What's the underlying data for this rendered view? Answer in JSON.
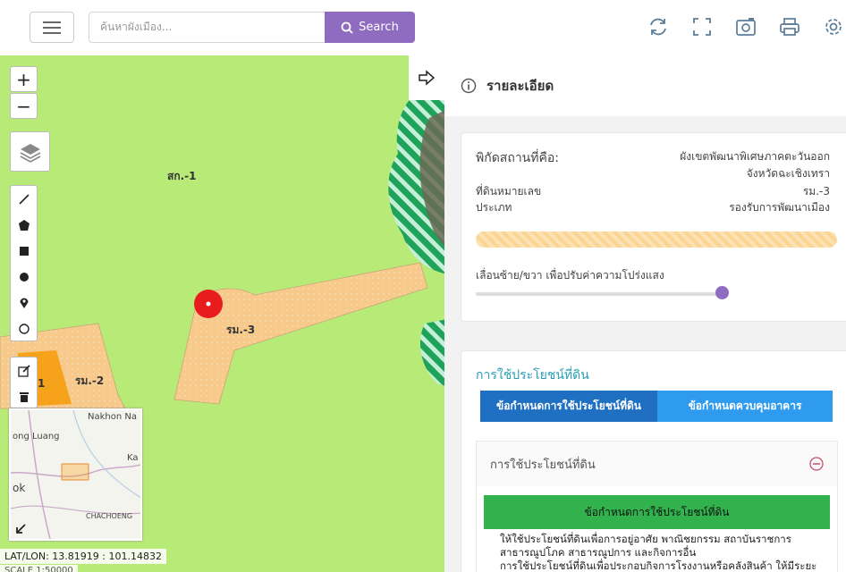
{
  "toolbar": {
    "search_placeholder": "ค้นหาผังเมือง...",
    "search_label": "Search",
    "icons": [
      "menu-icon",
      "search-icon",
      "refresh-icon",
      "fullscreen-icon",
      "screenshot-icon",
      "print-icon",
      "settings-icon"
    ]
  },
  "map": {
    "zoom_in": "+",
    "zoom_out": "−",
    "zones": [
      {
        "label": "สก.-1",
        "color": "#b8ea78"
      },
      {
        "label": "รม.-3",
        "color": "#f7c98b"
      },
      {
        "label": "รม.-2",
        "color": "#f7c98b"
      },
      {
        "label": "1",
        "color": "#f7a21b"
      }
    ],
    "minimap_labels": [
      "Nakhon Na",
      "ong Luang",
      "Ka",
      "ok",
      "CHACHOENG"
    ],
    "latlon": "LAT/LON: 13.81919 : 101.14832",
    "scale": "SCALE 1:50000",
    "marker_color": "#e81c1c"
  },
  "panel": {
    "title": "รายละเอียด",
    "details": [
      {
        "label": "พิกัดสถานที่คือ:",
        "value_line1": "ผังเขตพัฒนาพิเศษภาคตะวันออก",
        "value_line2": "จังหวัดฉะเชิงเทรา"
      },
      {
        "label": "ที่ดินหมายเลข",
        "value": "รม.-3"
      },
      {
        "label": "ประเภท",
        "value": "รองรับการพัฒนาเมือง"
      }
    ],
    "opacity_label": "เลื่อนซ้าย/ขวา เพื่อปรับค่าความโปร่งแสง",
    "opacity_level": 0.98,
    "landuse_title": "การใช้ประโยชน์ที่ดิน",
    "tabs": [
      "ข้อกำหนดการใช้ประโยชน์ที่ดิน",
      "ข้อกำหนดควบคุมอาคาร"
    ],
    "accordion_title": "การใช้ประโยชน์ที่ดิน",
    "green_header": "ข้อกำหนดการใช้ประโยชน์ที่ดิน",
    "text_lines": [
      "ให้ใช้ประโยชน์ที่ดินเพื่อการอยู่อาศัย พาณิชยกรรม สถาบันราชการ",
      "สาธารณูปโภค สาธารณูปการ และกิจการอื่น",
      "การใช้ประโยชน์ที่ดินเพื่อประกอบกิจการโรงงานหรือคลังสินค้า ให้มีระยะ"
    ]
  },
  "colors": {
    "accent": "#8f6cc0",
    "tab_active": "#1f6fc2",
    "tab": "#2e9bef",
    "green": "#31b24d",
    "title_teal": "#2a9fb6"
  }
}
